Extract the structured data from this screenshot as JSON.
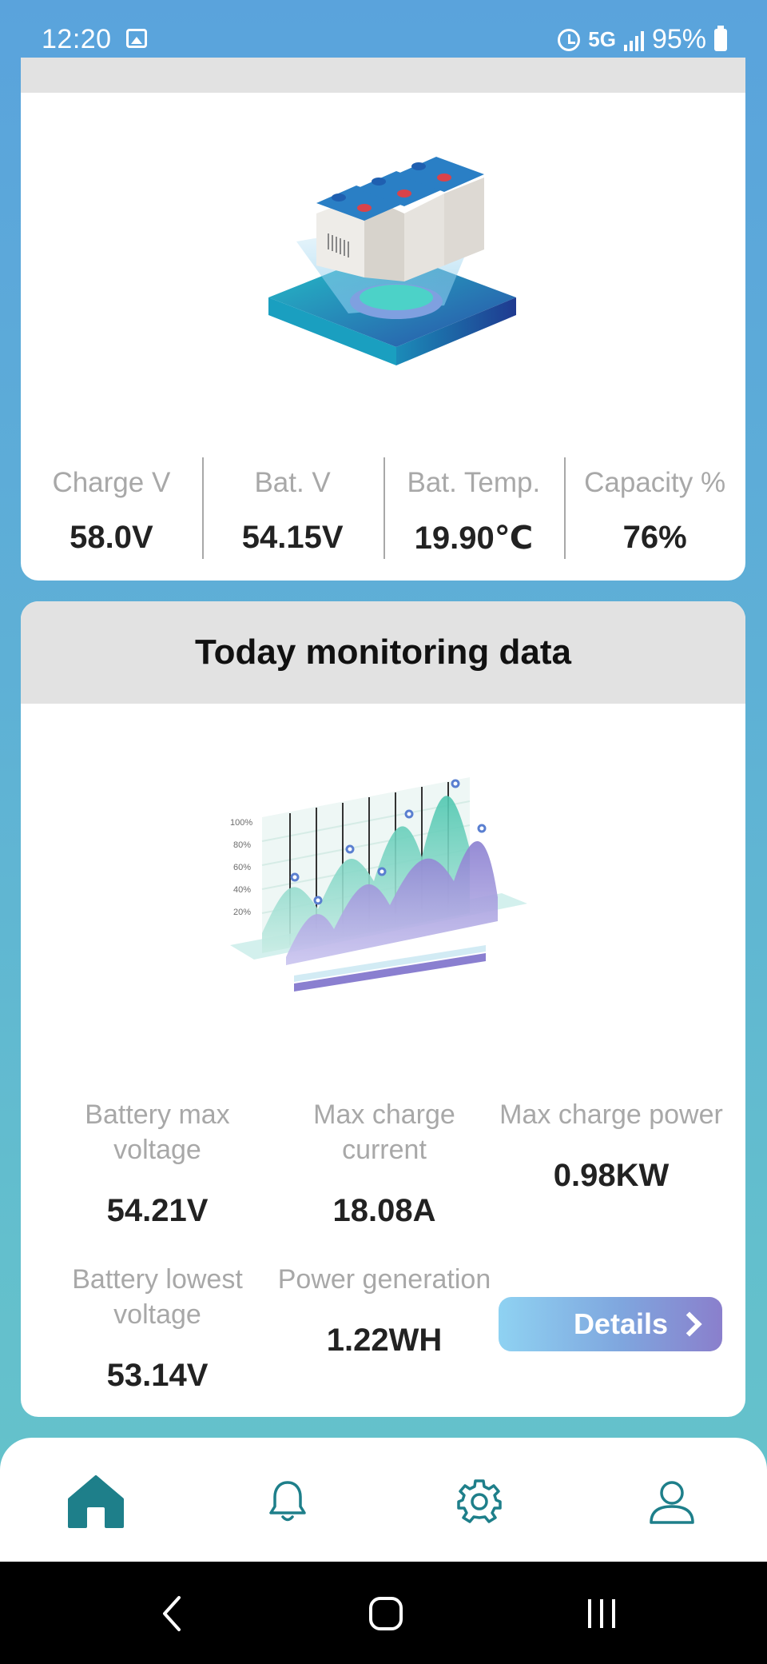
{
  "status_bar": {
    "time": "12:20",
    "network": "5G",
    "battery": "95%"
  },
  "battery_card": {
    "metrics": [
      {
        "label": "Charge V",
        "value": "58.0V"
      },
      {
        "label": "Bat. V",
        "value": "54.15V"
      },
      {
        "label": "Bat. Temp.",
        "value": "19.90℃"
      },
      {
        "label": "Capacity %",
        "value": "76%"
      }
    ]
  },
  "monitoring": {
    "title": "Today monitoring data",
    "chart_ticks": [
      "100%",
      "80%",
      "60%",
      "40%",
      "20%"
    ],
    "stats": [
      {
        "label": "Battery max voltage",
        "value": "54.21V"
      },
      {
        "label": "Max charge current",
        "value": "18.08A"
      },
      {
        "label": "Max charge power",
        "value": "0.98KW"
      },
      {
        "label": "Battery lowest voltage",
        "value": "53.14V"
      },
      {
        "label": "Power generation",
        "value": "1.22WH"
      }
    ],
    "details_label": "Details"
  },
  "bottom_nav": {
    "items": [
      "home-icon",
      "bell-icon",
      "gear-icon",
      "user-icon"
    ],
    "active_color": "#1e7f8a"
  }
}
